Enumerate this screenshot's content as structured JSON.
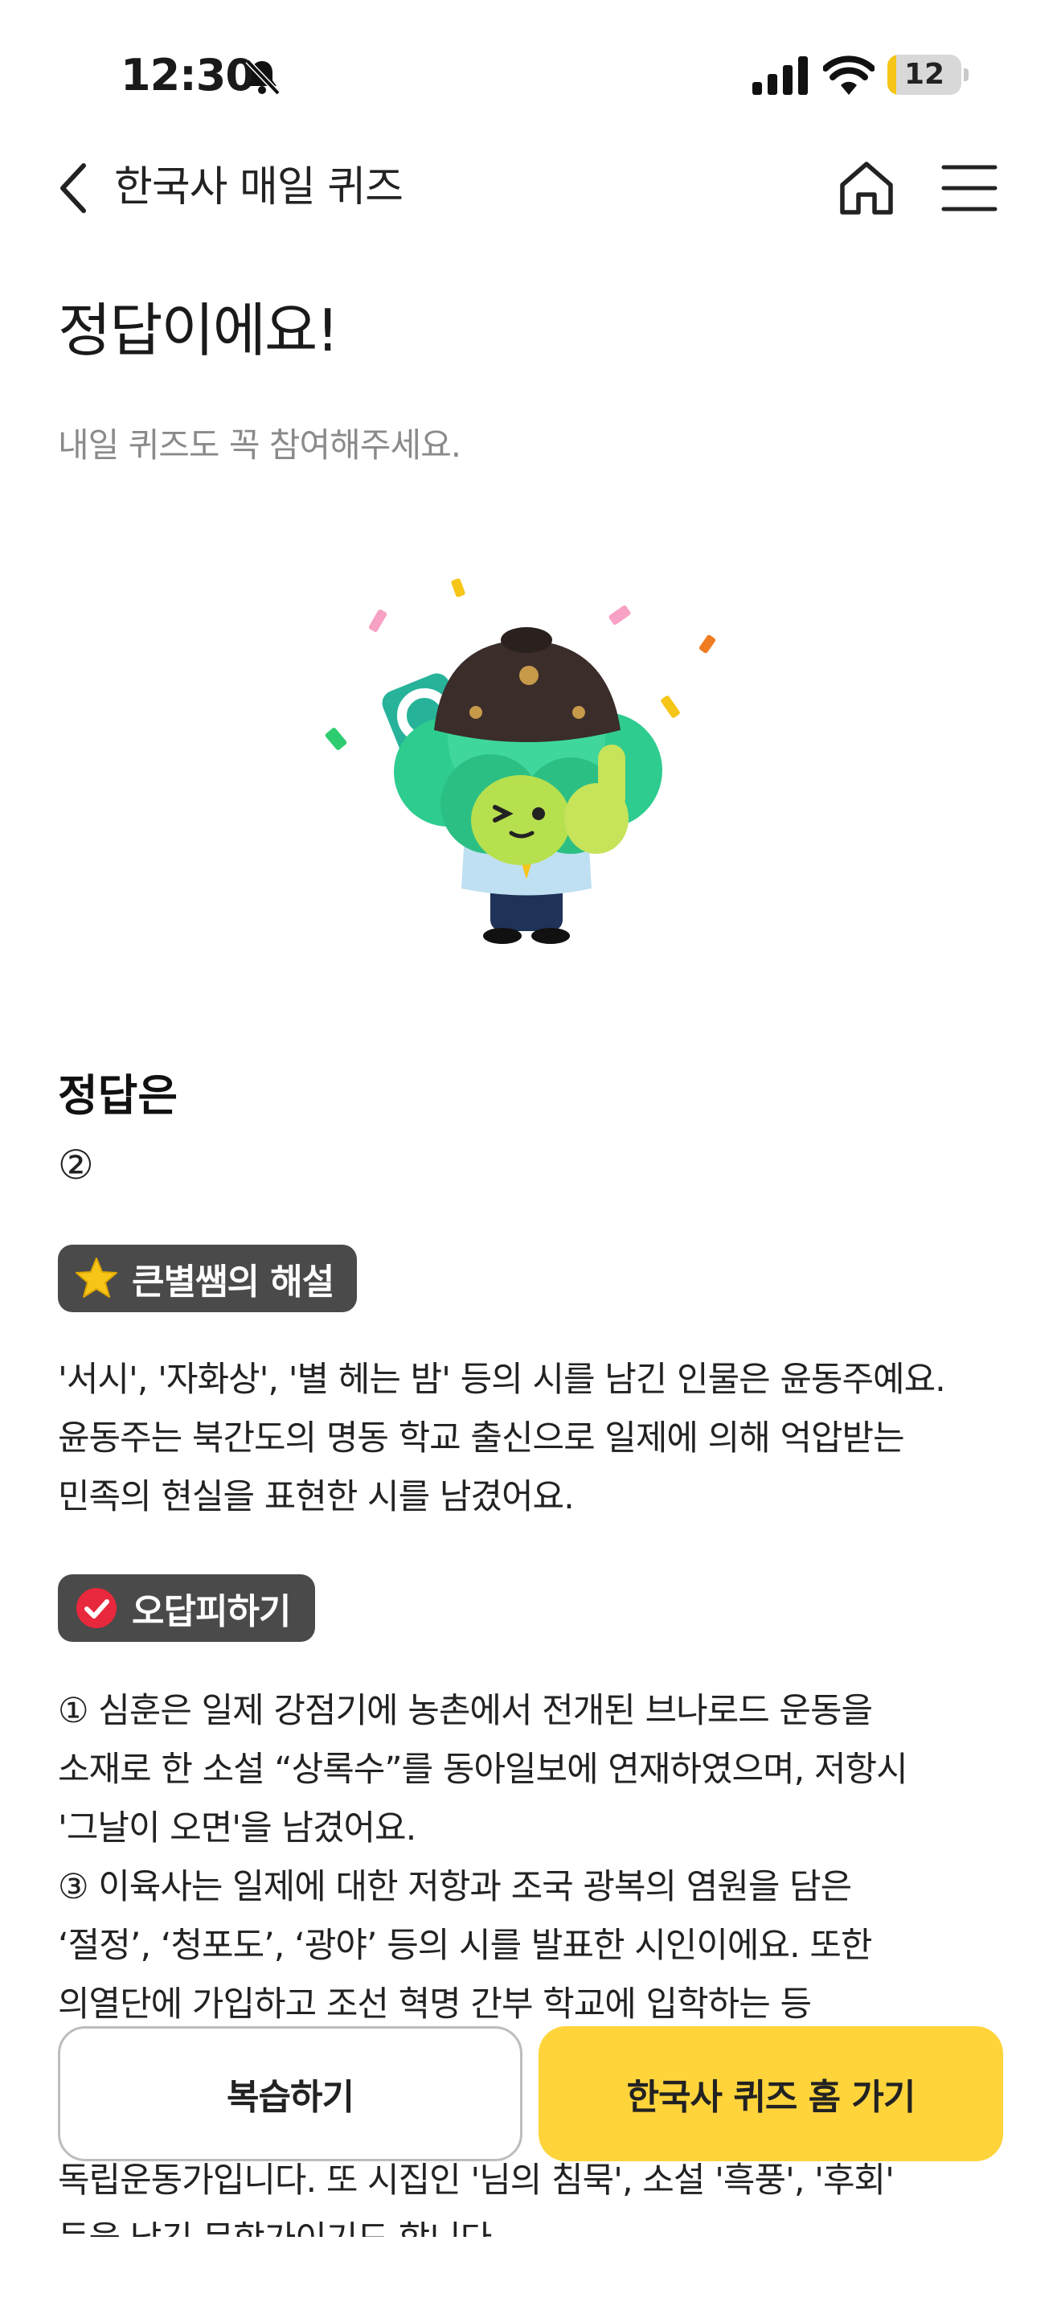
{
  "status_bar": {
    "time": "12:30",
    "battery_level": "12",
    "icons": [
      "bell-slash-icon",
      "cellular-signal-icon",
      "wifi-icon",
      "battery-icon"
    ]
  },
  "nav": {
    "title": "한국사 매일 퀴즈",
    "icons": [
      "chevron-left-icon",
      "home-icon",
      "hamburger-menu-icon"
    ]
  },
  "result": {
    "headline": "정답이에요!",
    "subtitle": "내일 퀴즈도 꼭 참여해주세요."
  },
  "answer": {
    "label": "정답은",
    "value": "②"
  },
  "explanation": {
    "badge_label": "큰별쌤의 해설",
    "badge_icon": "star-icon",
    "lines": [
      "'서시', '자화상', '별 헤는 밤' 등의 시를 남긴 인물은 윤동주예요.",
      "윤동주는 북간도의 명동 학교 출신으로 일제에 의해 억압받는",
      "민족의 현실을 표현한 시를 남겼어요."
    ]
  },
  "wrong_answers": {
    "badge_label": "오답피하기",
    "badge_icon": "check-circle-icon",
    "lines": [
      "① 심훈은 일제 강점기에 농촌에서 전개된 브나로드 운동을",
      "소재로 한 소설 “상록수”를 동아일보에 연재하였으며, 저항시",
      "'그날이 오면'을 남겼어요.",
      "③ 이육사는 일제에 대한 저항과 조국 광복의 염원을 담은",
      "‘절정’, ‘청포도’, ‘광야’ 등의 시를 발표한 시인이에요. 또한",
      "의열단에 가입하고 조선 혁명 간부 학교에 입학하는 등",
      "",
      "",
      "독립운동가입니다. 또 시집인 '님의 침묵', 소설 '흑풍', '후회'",
      "등을 남긴 문학가이기도 합니다."
    ]
  },
  "actions": {
    "review_label": "복습하기",
    "home_label": "한국사 퀴즈 홈 가기"
  },
  "colors": {
    "accent": "#FFD43B",
    "badge_bg": "#4A4A4A",
    "subtitle_text": "#8A8A8A",
    "mascot_green": "#3CC88C"
  }
}
